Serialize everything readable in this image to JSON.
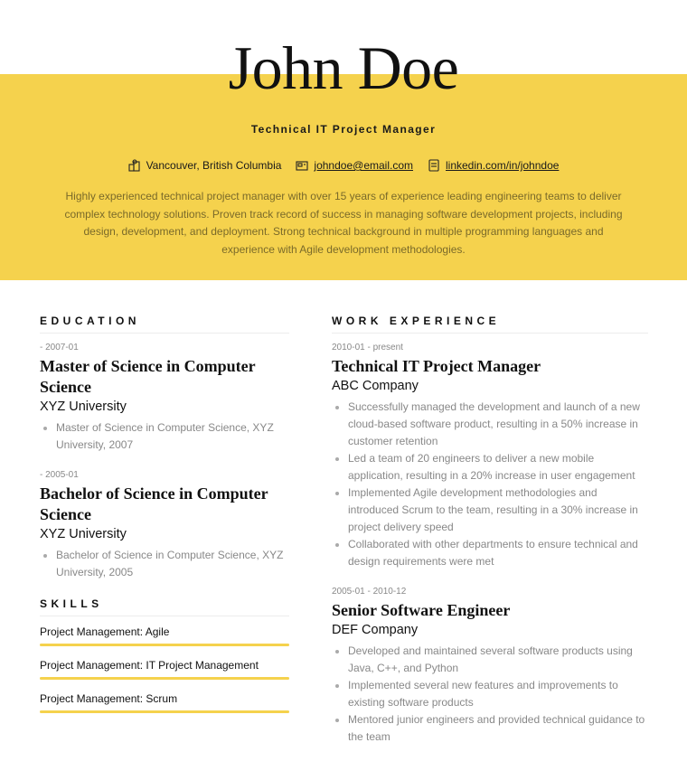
{
  "header": {
    "name": "John Doe",
    "role": "Technical IT Project Manager",
    "contacts": [
      {
        "icon": "location-icon",
        "text": "Vancouver, British Columbia",
        "link": false
      },
      {
        "icon": "email-icon",
        "text": "johndoe@email.com",
        "link": true
      },
      {
        "icon": "linkedin-icon",
        "text": "linkedin.com/in/johndoe",
        "link": true
      }
    ],
    "summary": "Highly experienced technical project manager with over 15 years of experience leading engineering teams to deliver complex technology solutions. Proven track record of success in managing software development projects, including design, development, and deployment. Strong technical background in multiple programming languages and experience with Agile development methodologies."
  },
  "colors": {
    "accent": "#f5d24d",
    "text": "#111111",
    "muted": "#888888"
  },
  "education": {
    "title": "EDUCATION",
    "items": [
      {
        "date": "- 2007-01",
        "degree": "Master of Science in Computer Science",
        "school": "XYZ University",
        "bullets": [
          "Master of Science in Computer Science, XYZ University, 2007"
        ]
      },
      {
        "date": "- 2005-01",
        "degree": "Bachelor of Science in Computer Science",
        "school": "XYZ University",
        "bullets": [
          "Bachelor of Science in Computer Science, XYZ University, 2005"
        ]
      }
    ]
  },
  "skills": {
    "title": "SKILLS",
    "items": [
      {
        "name": "Project Management: Agile",
        "level": 1.0
      },
      {
        "name": "Project Management: IT Project Management",
        "level": 1.0
      },
      {
        "name": "Project Management: Scrum",
        "level": 1.0
      }
    ]
  },
  "work": {
    "title": "WORK EXPERIENCE",
    "items": [
      {
        "date": "2010-01 - present",
        "title": "Technical IT Project Manager",
        "company": "ABC Company",
        "bullets": [
          "Successfully managed the development and launch of a new cloud-based software product, resulting in a 50% increase in customer retention",
          "Led a team of 20 engineers to deliver a new mobile application, resulting in a 20% increase in user engagement",
          "Implemented Agile development methodologies and introduced Scrum to the team, resulting in a 30% increase in project delivery speed",
          "Collaborated with other departments to ensure technical and design requirements were met"
        ]
      },
      {
        "date": "2005-01 - 2010-12",
        "title": "Senior Software Engineer",
        "company": "DEF Company",
        "bullets": [
          "Developed and maintained several software products using Java, C++, and Python",
          "Implemented several new features and improvements to existing software products",
          "Mentored junior engineers and provided technical guidance to the team"
        ]
      }
    ]
  }
}
